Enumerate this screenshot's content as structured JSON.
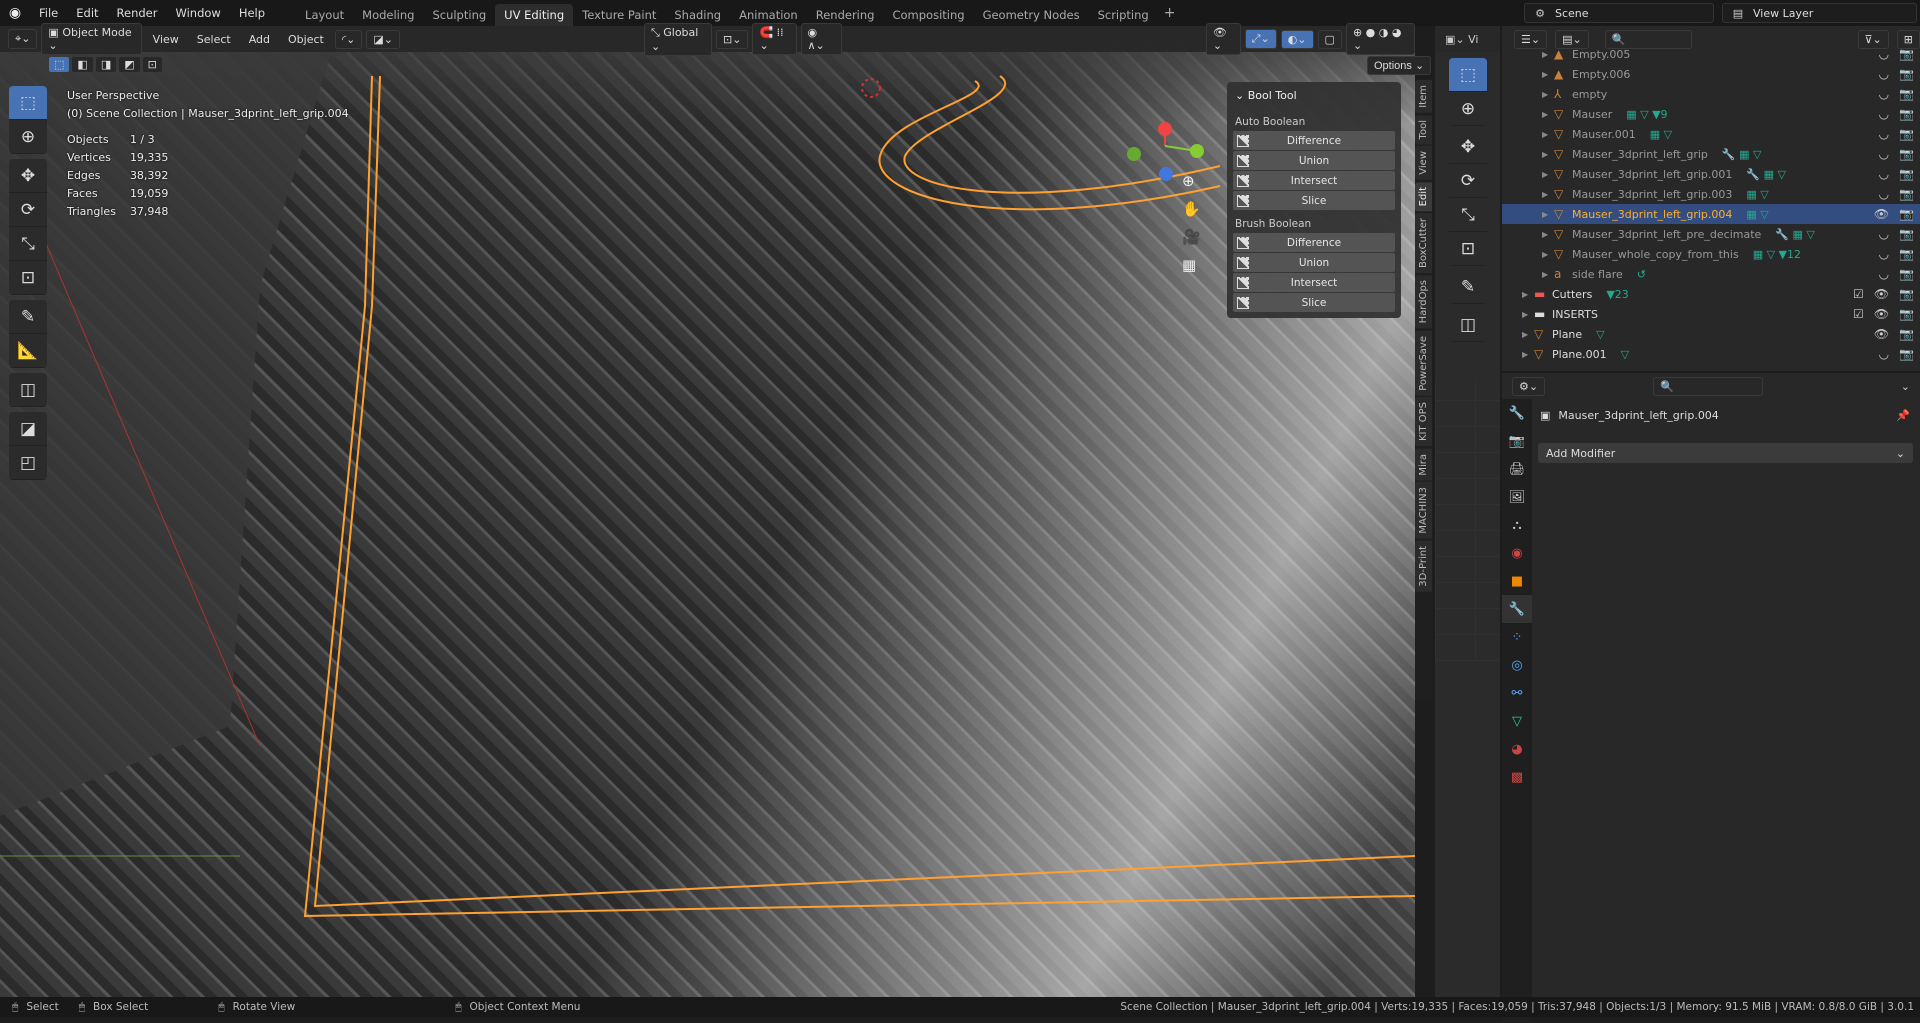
{
  "topbar": {
    "menus": [
      "File",
      "Edit",
      "Render",
      "Window",
      "Help"
    ],
    "workspaces": [
      "Layout",
      "Modeling",
      "Sculpting",
      "UV Editing",
      "Texture Paint",
      "Shading",
      "Animation",
      "Rendering",
      "Compositing",
      "Geometry Nodes",
      "Scripting"
    ],
    "active_workspace": "UV Editing",
    "add_tab": "+",
    "scene": "Scene",
    "view_layer": "View Layer"
  },
  "viewport_header": {
    "mode": "Object Mode",
    "menus": [
      "View",
      "Select",
      "Add",
      "Object"
    ],
    "orientation": "Global",
    "options": "Options"
  },
  "overlay": {
    "view_name": "User Perspective",
    "collection": "(0) Scene Collection | Mauser_3dprint_left_grip.004",
    "stats": [
      {
        "label": "Objects",
        "value": "1 / 3"
      },
      {
        "label": "Vertices",
        "value": "19,335"
      },
      {
        "label": "Edges",
        "value": "38,392"
      },
      {
        "label": "Faces",
        "value": "19,059"
      },
      {
        "label": "Triangles",
        "value": "37,948"
      }
    ]
  },
  "tools": [
    "select-box",
    "cursor",
    "move",
    "rotate",
    "scale",
    "transform",
    "annotate",
    "measure",
    "add-cube",
    "boxcutter",
    "hops"
  ],
  "bool_tool": {
    "title": "Bool Tool",
    "auto_label": "Auto Boolean",
    "brush_label": "Brush Boolean",
    "auto": [
      "Difference",
      "Union",
      "Intersect",
      "Slice"
    ],
    "brush": [
      "Difference",
      "Union",
      "Intersect",
      "Slice"
    ]
  },
  "n_tabs": [
    "Item",
    "Tool",
    "View",
    "Edit",
    "BoxCutter",
    "HardOps",
    "PowerSave",
    "KIT OPS",
    "Mira",
    "MACHIN3",
    "3D-Print"
  ],
  "active_n_tab": "Edit",
  "outliner": {
    "rows": [
      {
        "name": "Empty.005",
        "indent": 2,
        "icon": "empty-image",
        "extra": "",
        "sel": false
      },
      {
        "name": "Empty.006",
        "indent": 2,
        "icon": "empty-image",
        "extra": "",
        "sel": false
      },
      {
        "name": "empty",
        "indent": 2,
        "icon": "empty",
        "extra": "",
        "sel": false
      },
      {
        "name": "Mauser",
        "indent": 2,
        "icon": "mesh",
        "extra": "▦ ▽ ▼9",
        "sel": false
      },
      {
        "name": "Mauser.001",
        "indent": 2,
        "icon": "mesh",
        "extra": "▦ ▽",
        "sel": false
      },
      {
        "name": "Mauser_3dprint_left_grip",
        "indent": 2,
        "icon": "mesh",
        "extra": "🔧 ▦ ▽",
        "sel": false
      },
      {
        "name": "Mauser_3dprint_left_grip.001",
        "indent": 2,
        "icon": "mesh",
        "extra": "🔧 ▦ ▽",
        "sel": false
      },
      {
        "name": "Mauser_3dprint_left_grip.003",
        "indent": 2,
        "icon": "mesh",
        "extra": "▦ ▽",
        "sel": false
      },
      {
        "name": "Mauser_3dprint_left_grip.004",
        "indent": 2,
        "icon": "mesh",
        "extra": "▦ ▽",
        "sel": true
      },
      {
        "name": "Mauser_3dprint_left_pre_decimate",
        "indent": 2,
        "icon": "mesh",
        "extra": "🔧 ▦ ▽",
        "sel": false
      },
      {
        "name": "Mauser_whole_copy_from_this",
        "indent": 2,
        "icon": "mesh",
        "extra": "▦ ▽ ▼12",
        "sel": false
      },
      {
        "name": "side flare",
        "indent": 2,
        "icon": "text",
        "extra": "↺",
        "sel": false
      },
      {
        "name": "Cutters",
        "indent": 1,
        "icon": "collection",
        "extra": "▼23",
        "sel": false
      },
      {
        "name": "INSERTS",
        "indent": 1,
        "icon": "collection",
        "extra": "",
        "sel": false
      },
      {
        "name": "Plane",
        "indent": 1,
        "icon": "mesh",
        "extra": "▽",
        "sel": false
      },
      {
        "name": "Plane.001",
        "indent": 1,
        "icon": "mesh",
        "extra": "▽",
        "sel": false
      }
    ]
  },
  "properties": {
    "object_name": "Mauser_3dprint_left_grip.004",
    "add_modifier": "Add Modifier"
  },
  "statusbar": {
    "select": "Select",
    "box_select": "Box Select",
    "rotate_view": "Rotate View",
    "context_menu": "Object Context Menu",
    "info": "Scene Collection | Mauser_3dprint_left_grip.004 | Verts:19,335 | Faces:19,059 | Tris:37,948 | Objects:1/3 | Memory: 91.5 MiB | VRAM: 0.8/8.0 GiB | 3.0.1"
  },
  "colors": {
    "accent": "#4772b3",
    "selection_outline": "#ffa030",
    "selected_text": "#ffaf29"
  }
}
